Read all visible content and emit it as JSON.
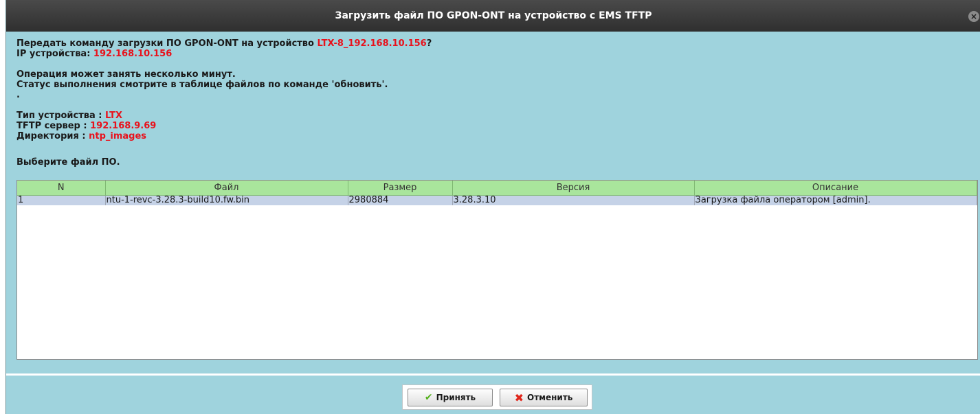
{
  "window": {
    "title": "Загрузить файл ПО GPON-ONT на устройство с EMS TFTP",
    "close_glyph": "×"
  },
  "info": {
    "prompt_prefix": "Передать команду загрузки ПО GPON-ONT на устройство ",
    "device_name": "LTX-8_192.168.10.156",
    "prompt_suffix": "?",
    "ip_label": "IP устройства: ",
    "ip_value": "192.168.10.156",
    "op_line1": "Операция может занять несколько минут.",
    "op_line2": "Статус выполнения смотрите в таблице файлов по команде 'обновить'.",
    "dot": ".",
    "type_label": "Тип устройства : ",
    "type_value": "LTX",
    "tftp_label": "TFTP сервер : ",
    "tftp_value": "192.168.9.69",
    "dir_label": "Директория : ",
    "dir_value": "ntp_images",
    "select_prompt": "Выберите файл ПО."
  },
  "table": {
    "headers": [
      "N",
      "Файл",
      "Размер",
      "Версия",
      "Описание"
    ],
    "rows": [
      [
        "1",
        "ntu-1-revc-3.28.3-build10.fw.bin",
        "2980884",
        "3.28.3.10",
        "Загрузка файла оператором [admin]."
      ]
    ]
  },
  "buttons": {
    "accept": "Принять",
    "cancel": "Отменить"
  },
  "colors": {
    "background": "#9fd3dd",
    "header": "#a9e59c",
    "selected_row": "#c5d2e7",
    "highlight_text": "#e8121c"
  }
}
